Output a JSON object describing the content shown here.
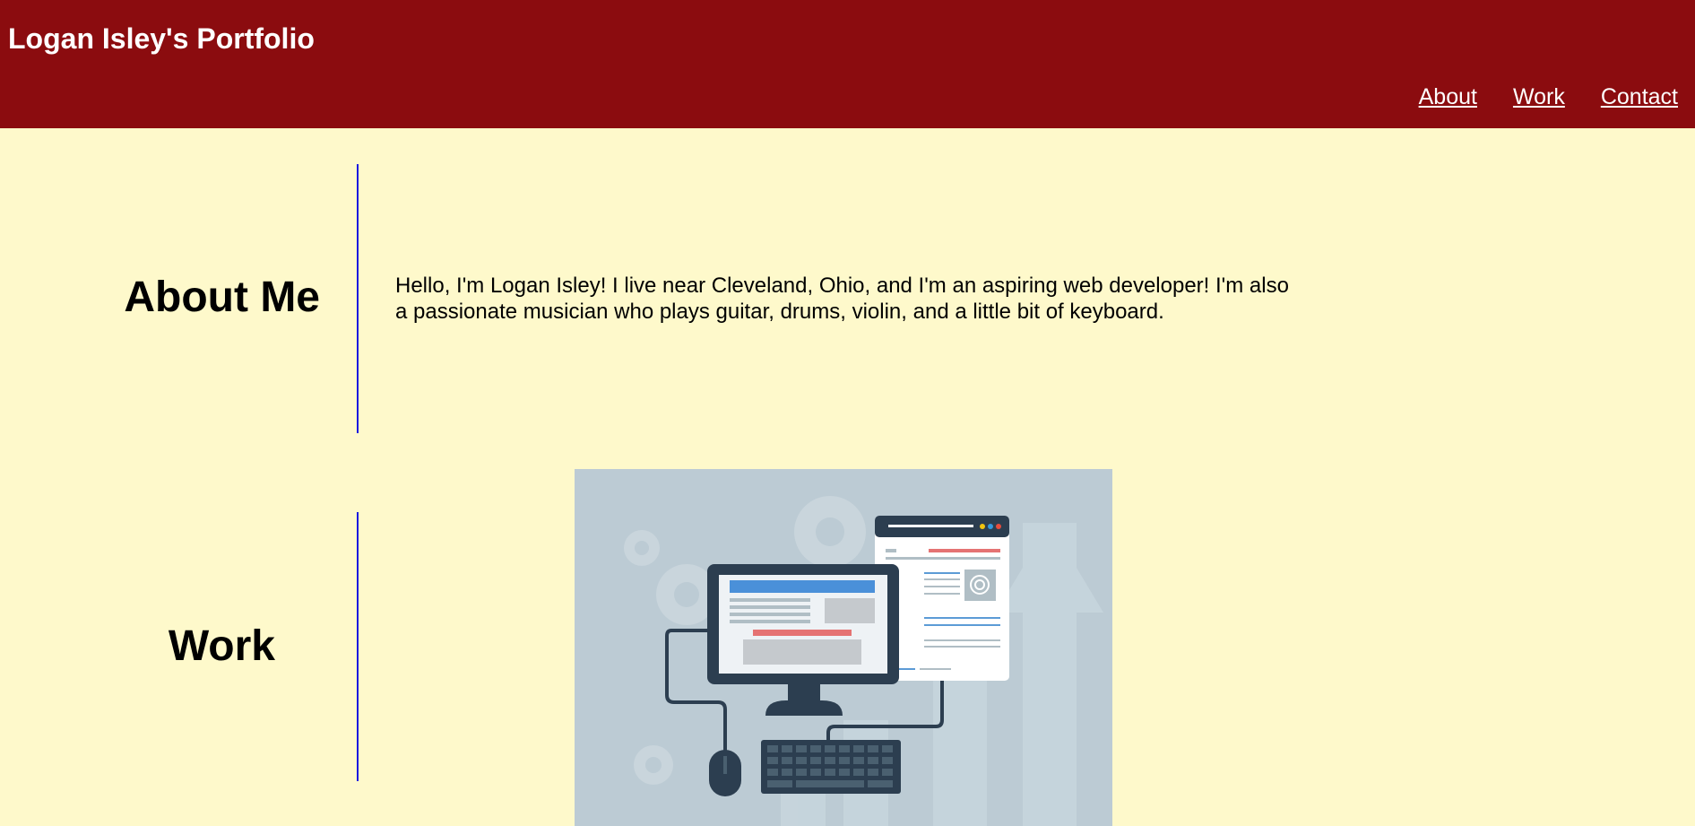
{
  "header": {
    "title": "Logan Isley's Portfolio",
    "nav": [
      {
        "label": "About"
      },
      {
        "label": "Work"
      },
      {
        "label": "Contact"
      }
    ]
  },
  "about": {
    "heading": "About Me",
    "text": "Hello, I'm Logan Isley! I live near Cleveland, Ohio, and I'm an aspiring web developer! I'm also a passionate musician who plays guitar, drums, violin, and a little bit of keyboard."
  },
  "work": {
    "heading": "Work"
  },
  "colors": {
    "header_bg": "#8b0c0f",
    "page_bg": "#fef9cb",
    "divider": "#1a1ae0"
  }
}
